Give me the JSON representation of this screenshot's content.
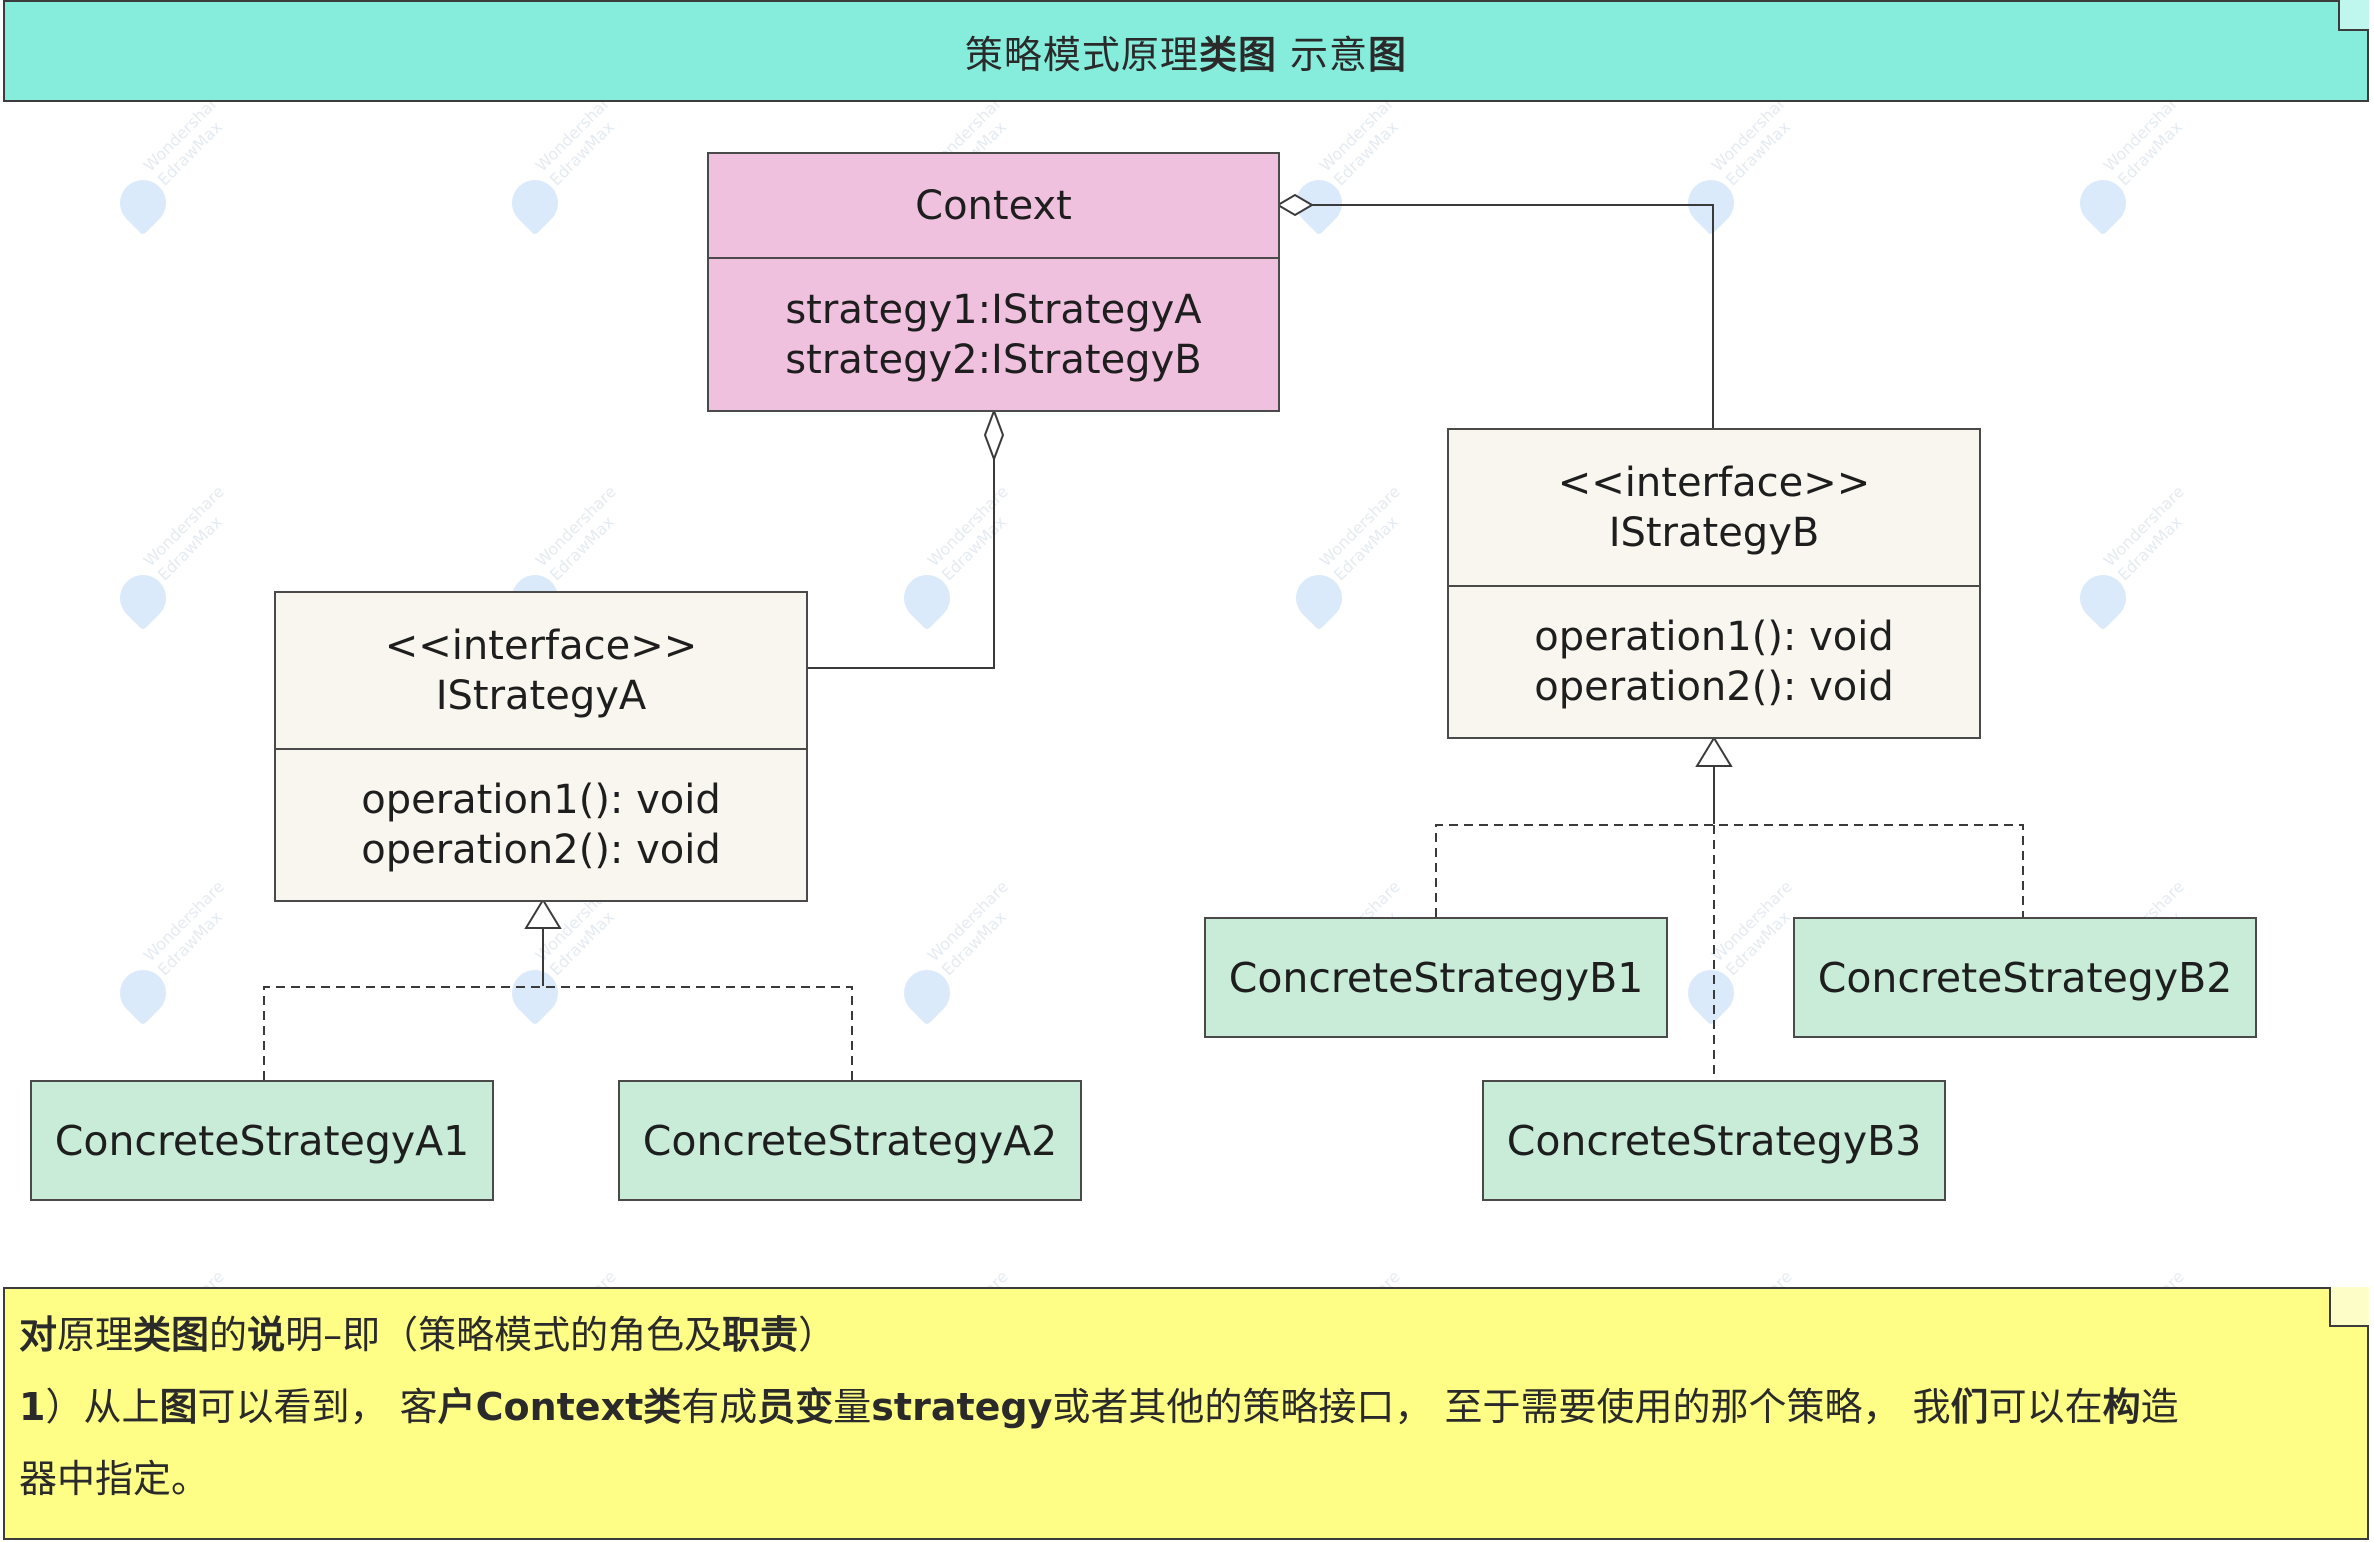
{
  "banner": {
    "title_part1": "策略模式原理",
    "title_bold1": "类图",
    "title_part2": " 示意",
    "title_bold2": "图"
  },
  "classes": {
    "context": {
      "name": "Context",
      "attr1": "strategy1:IStrategyA",
      "attr2": "strategy2:IStrategyB"
    },
    "istrategy_a": {
      "stereotype": "<<interface>>",
      "name": "IStrategyA",
      "op1": "operation1(): void",
      "op2": "operation2(): void"
    },
    "istrategy_b": {
      "stereotype": "<<interface>>",
      "name": "IStrategyB",
      "op1": "operation1(): void",
      "op2": "operation2(): void"
    },
    "concrete_a1": {
      "name": "ConcreteStrategyA1"
    },
    "concrete_a2": {
      "name": "ConcreteStrategyA2"
    },
    "concrete_b1": {
      "name": "ConcreteStrategyB1"
    },
    "concrete_b2": {
      "name": "ConcreteStrategyB2"
    },
    "concrete_b3": {
      "name": "ConcreteStrategyB3"
    }
  },
  "note": {
    "l1_b1": "对",
    "l1_t1": "原理",
    "l1_b2": "类图",
    "l1_t2": "的",
    "l1_b3": "说",
    "l1_t3": "明–即（策略模式的角色及",
    "l1_b4": "职责",
    "l1_t4": "）",
    "l2_b1": "1",
    "l2_t1": "）从上",
    "l2_b2": "图",
    "l2_t2": "可以看到， 客",
    "l2_b3": "户Context类",
    "l2_t3": "有成",
    "l2_b4": "员变",
    "l2_t4": "量",
    "l2_b5": "strategy",
    "l2_t5": "或者其他的策略接口， 至于需要使用的那个策略， 我",
    "l2_b6": "们",
    "l2_t6": "可以在",
    "l2_b7": "构",
    "l2_t7": "造",
    "l3_t1": "器中指定。"
  },
  "watermark": {
    "line1": "Wondershare",
    "line2": "EdrawMax",
    "color": "#3f8ee8"
  },
  "colors": {
    "banner": "#86ecdc",
    "context": "#f0c1de",
    "interface": "#f8f6ef",
    "concrete": "#c9ecd9",
    "note": "#fefe87"
  }
}
